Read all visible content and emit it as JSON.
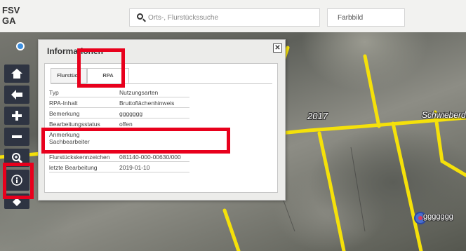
{
  "header": {
    "logo_line1": "FSV",
    "logo_line2": "GA",
    "search_placeholder": "Orts-, Flurstückssuche",
    "layer_select": "Farbbild"
  },
  "map": {
    "label_2017": "2017",
    "street_label": "Schwieberdi",
    "marker_label": "ggggggg"
  },
  "toolbar": {
    "items": [
      "home-icon",
      "back-arrow-icon",
      "zoom-in-icon",
      "zoom-out-icon",
      "zoom-extent-icon",
      "info-icon",
      "eraser-icon"
    ]
  },
  "dialog": {
    "title": "Informationen",
    "close": "✕",
    "tabs": [
      "Flurstück",
      "RPA"
    ],
    "rows": [
      {
        "key": "Typ",
        "value": "Nutzungsarten"
      },
      {
        "key": "RPA-Inhalt",
        "value": "Bruttoflächenhinweis"
      },
      {
        "key": "Bemerkung",
        "value": "ggggggg"
      },
      {
        "key": "Bearbeitungsstatus",
        "value": "offen"
      },
      {
        "key": "Anmerkung",
        "key2": "Sachbearbeiter",
        "value": ""
      },
      {
        "key": "Flurstückskennzeichen",
        "value": "081140-000-00630/000"
      },
      {
        "key": "letzte Bearbeitung",
        "value": "2019-01-10"
      }
    ]
  },
  "colors": {
    "highlight": "#e8001c",
    "road": "#f5e10a",
    "toolbar": "#2e3442"
  }
}
